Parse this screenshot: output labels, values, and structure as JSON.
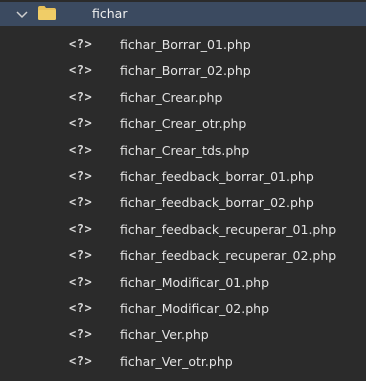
{
  "folder": {
    "name": "fichar",
    "expanded": true,
    "icon": "folder-icon",
    "chevron": "chevron-down-icon"
  },
  "files": [
    {
      "icon_text": "<?>",
      "name": "fichar_Borrar_01.php"
    },
    {
      "icon_text": "<?>",
      "name": "fichar_Borrar_02.php"
    },
    {
      "icon_text": "<?>",
      "name": "fichar_Crear.php"
    },
    {
      "icon_text": "<?>",
      "name": "fichar_Crear_otr.php"
    },
    {
      "icon_text": "<?>",
      "name": "fichar_Crear_tds.php"
    },
    {
      "icon_text": "<?>",
      "name": "fichar_feedback_borrar_01.php"
    },
    {
      "icon_text": "<?>",
      "name": "fichar_feedback_borrar_02.php"
    },
    {
      "icon_text": "<?>",
      "name": "fichar_feedback_recuperar_01.php"
    },
    {
      "icon_text": "<?>",
      "name": "fichar_feedback_recuperar_02.php"
    },
    {
      "icon_text": "<?>",
      "name": "fichar_Modificar_01.php"
    },
    {
      "icon_text": "<?>",
      "name": "fichar_Modificar_02.php"
    },
    {
      "icon_text": "<?>",
      "name": "fichar_Ver.php"
    },
    {
      "icon_text": "<?>",
      "name": "fichar_Ver_otr.php"
    }
  ],
  "colors": {
    "background": "#2b2b2b",
    "selected_row": "#3b4a60",
    "folder": "#e8c15a",
    "text": "#e3e3e3"
  }
}
